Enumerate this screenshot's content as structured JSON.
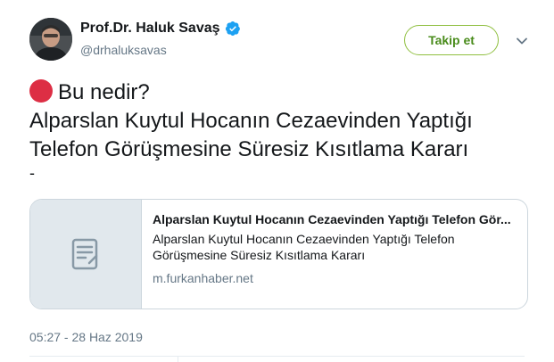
{
  "author": {
    "name": "Prof.Dr. Haluk Savaş",
    "handle": "@drhaluksavas",
    "verified": true
  },
  "follow_button": {
    "label": "Takip et",
    "color": "#4a8c1c"
  },
  "tweet": {
    "lines": [
      "Bu nedir?",
      "Alparslan Kuytul Hocanın Cezaevinden Yaptığı",
      "Telefon Görüşmesine Süresiz Kısıtlama Kararı",
      "-"
    ],
    "leading_emoji": "red-circle"
  },
  "link_card": {
    "title": "Alparslan Kuytul Hocanın Cezaevinden Yaptığı Telefon Gör...",
    "description": "Alparslan Kuytul Hocanın Cezaevinden Yaptığı Telefon Görüşmesine Süresiz Kısıtlama Kararı",
    "domain": "m.furkanhaber.net",
    "thumbnail_icon": "document-icon"
  },
  "timestamp": "05:27 - 28 Haz 2019",
  "colors": {
    "accent_blue": "#1da1f2",
    "secondary_text": "#657786",
    "border": "#ccd6dd",
    "red_emoji": "#dd2e44"
  }
}
